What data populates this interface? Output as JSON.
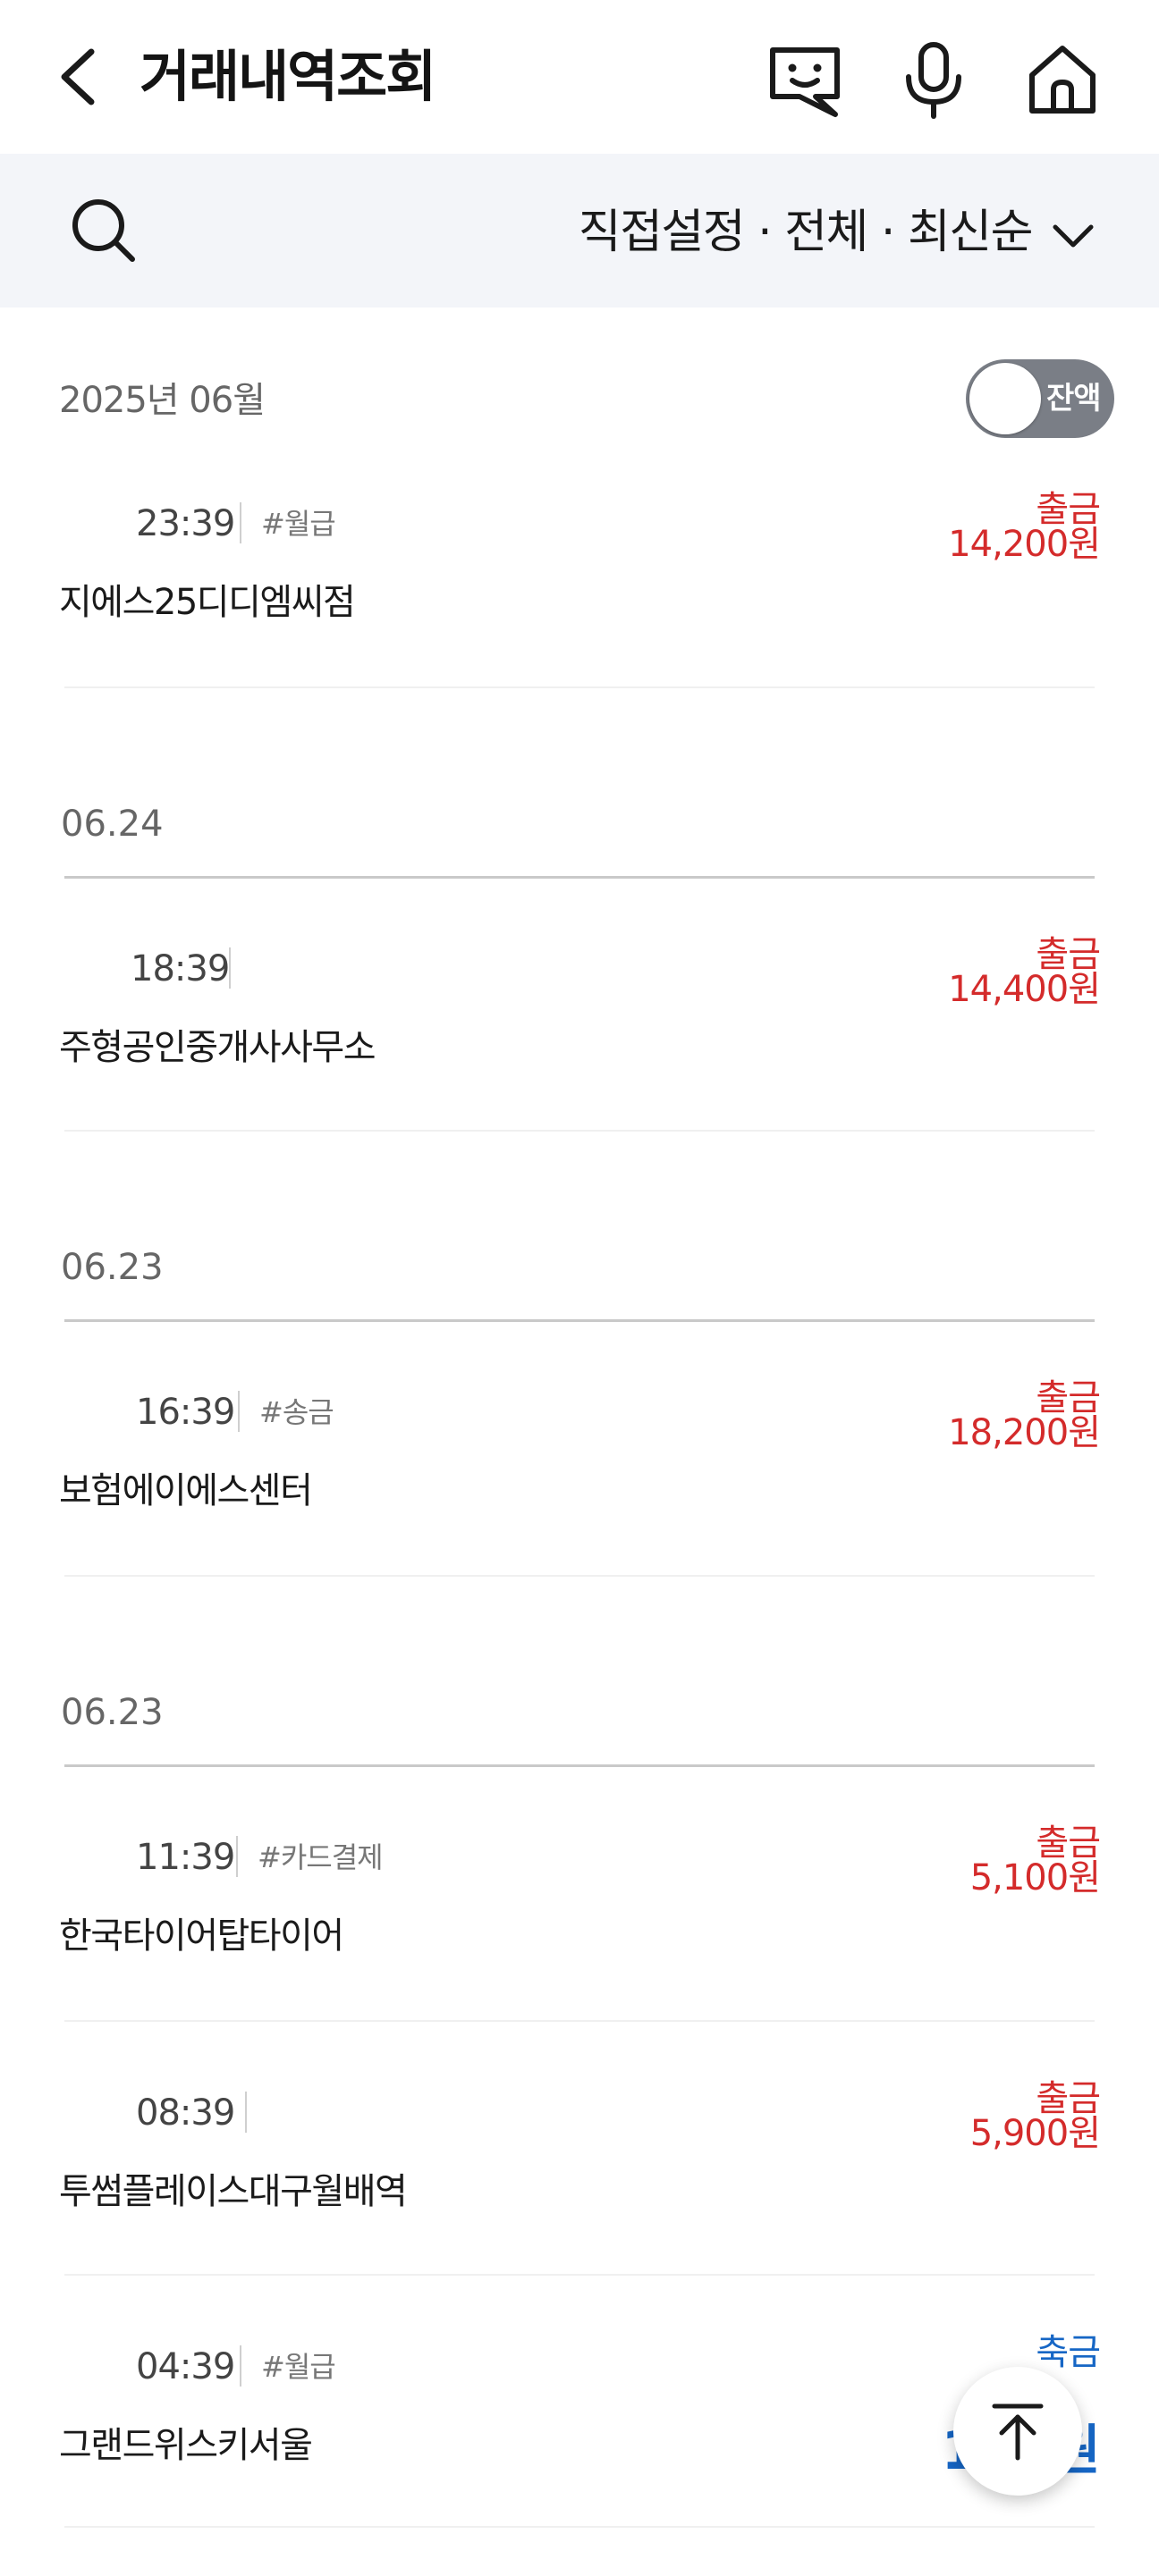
{
  "header": {
    "title": "거래내역조회",
    "back_icon": "chevron-left-icon",
    "chat_icon": "chatbot-icon",
    "mic_icon": "microphone-icon",
    "home_icon": "home-icon"
  },
  "filter": {
    "search_icon": "search-icon",
    "label": "직접설정 · 전체 · 최신순",
    "chevron_icon": "chevron-down-icon"
  },
  "month": {
    "label": "2025년 06월",
    "balance_toggle_label": "잔액",
    "balance_toggle_on": false
  },
  "colors": {
    "withdrawal": "#d42b2b",
    "deposit": "#1666c5",
    "filter_bg": "#f3f5f9",
    "toggle_bg": "#7a7e86"
  },
  "sections": [
    {
      "date": "",
      "transactions": [
        {
          "time": "23:39",
          "tag": "#월급",
          "merchant": "지에스25디디엠씨점",
          "type": "출금",
          "amount": "14,200원"
        }
      ]
    },
    {
      "date": "06.24",
      "transactions": [
        {
          "time": "18:39",
          "tag": "",
          "merchant": "주형공인중개사사무소",
          "type": "출금",
          "amount": "14,400원"
        }
      ]
    },
    {
      "date": "06.23",
      "transactions": [
        {
          "time": "16:39",
          "tag": "#송금",
          "merchant": "보험에이에스센터",
          "type": "출금",
          "amount": "18,200원"
        }
      ]
    },
    {
      "date": "06.23",
      "transactions": [
        {
          "time": "11:39",
          "tag": "#카드결제",
          "merchant": "한국타이어탑타이어",
          "type": "출금",
          "amount": "5,100원"
        },
        {
          "time": "08:39",
          "tag": "",
          "merchant": "투썸플레이스대구월배역",
          "type": "출금",
          "amount": "5,900원"
        },
        {
          "time": "04:39",
          "tag": "#월급",
          "merchant": "그랜드위스키서울",
          "type": "축금",
          "amount": "12,   원"
        }
      ]
    }
  ],
  "scroll_top": {
    "icon": "arrow-up-icon"
  }
}
